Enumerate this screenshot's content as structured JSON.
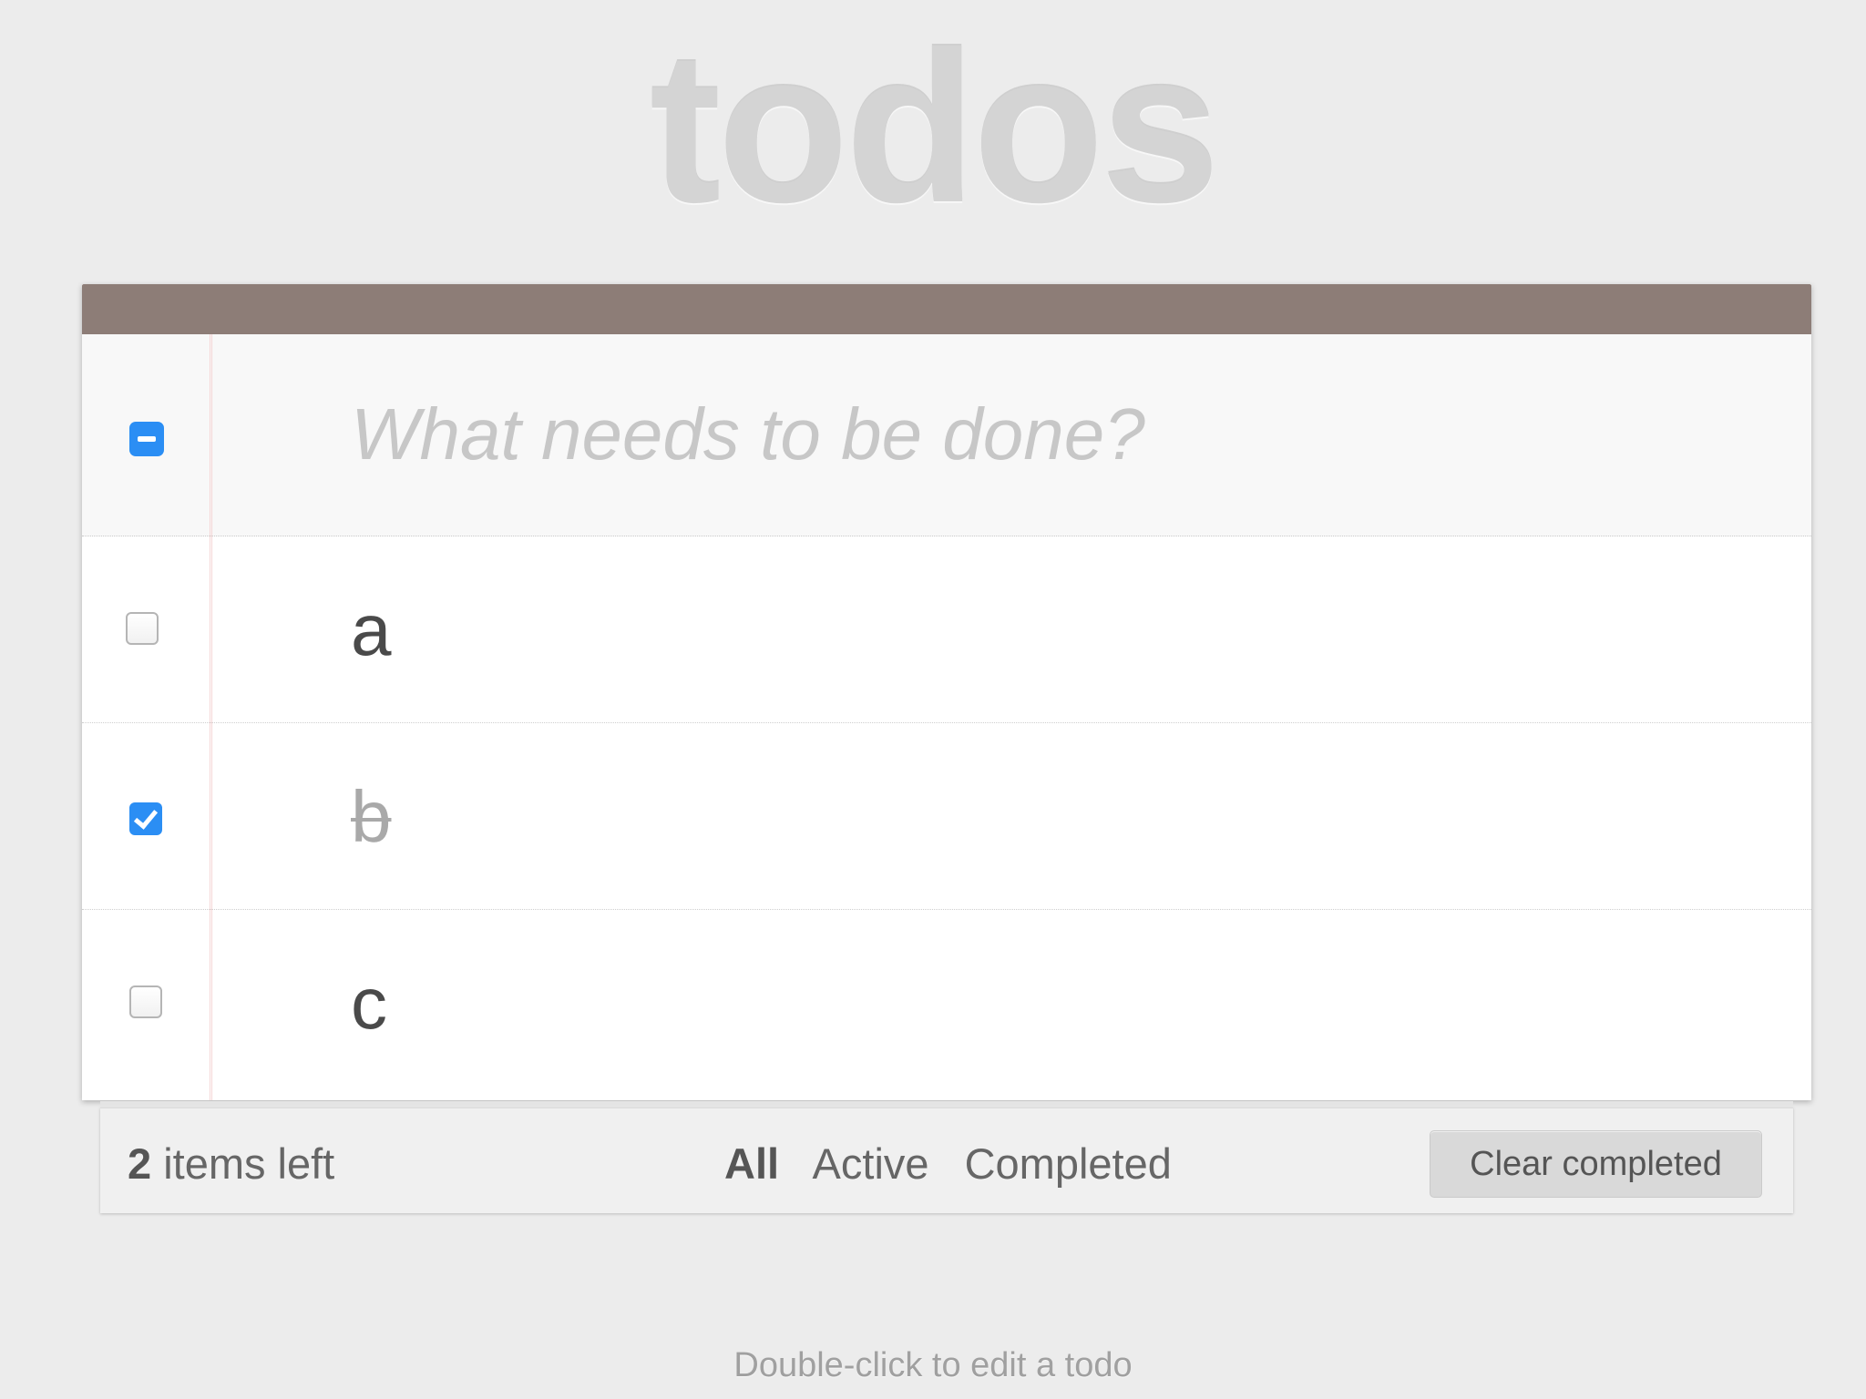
{
  "header": {
    "title": "todos",
    "bar_color": "#8d7d77"
  },
  "new_todo": {
    "placeholder": "What needs to be done?",
    "value": "",
    "toggle_all_state": "partial"
  },
  "todos": [
    {
      "label": "a",
      "completed": false
    },
    {
      "label": "b",
      "completed": true
    },
    {
      "label": "c",
      "completed": false
    }
  ],
  "footer": {
    "count_number": "2",
    "count_suffix": " items left",
    "filters": [
      {
        "label": "All",
        "selected": true
      },
      {
        "label": "Active",
        "selected": false
      },
      {
        "label": "Completed",
        "selected": false
      }
    ],
    "clear_label": "Clear completed"
  },
  "info": {
    "text": "Double-click to edit a todo"
  },
  "colors": {
    "accent": "#2b8ef4",
    "background": "#ececec"
  }
}
